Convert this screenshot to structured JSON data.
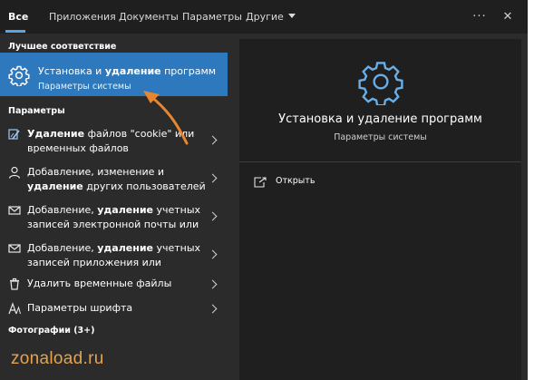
{
  "tabs": [
    {
      "label": "Все",
      "active": true
    },
    {
      "label": "Приложения"
    },
    {
      "label": "Документы"
    },
    {
      "label": "Параметры"
    },
    {
      "label": "Другие"
    }
  ],
  "top_icons": {
    "more": "···",
    "close": "✕"
  },
  "best_match": {
    "header": "Лучшее соответствие",
    "title_plain": "Установка и ",
    "title_bold": "удаление",
    "title_rest": " программ",
    "subtitle": "Параметры системы",
    "icon": "gear-icon"
  },
  "settings": {
    "header": "Параметры",
    "items": [
      {
        "icon": "cleanup-icon",
        "line1_bold": "Удаление",
        "line1_rest": " файлов \"cookie\" или",
        "line2": "временных файлов"
      },
      {
        "icon": "person-icon",
        "line1_plain": "Добавление, изменение и",
        "line2_bold": "удаление",
        "line2_rest": " других пользователей"
      },
      {
        "icon": "mail-icon",
        "line1_plain": "Добавление, ",
        "line1_bold": "удаление",
        "line1_rest": " учетных",
        "line2": "записей электронной почты или"
      },
      {
        "icon": "mail-icon",
        "line1_plain": "Добавление, ",
        "line1_bold": "удаление",
        "line1_rest": " учетных",
        "line2": "записей приложения или"
      },
      {
        "icon": "trash-icon",
        "line1_plain": "Удалить временные файлы"
      },
      {
        "icon": "font-icon",
        "line1_plain": "Параметры шрифта"
      }
    ]
  },
  "photos_header": "Фотографии (3+)",
  "preview": {
    "title": "Установка и удаление программ",
    "subtitle": "Параметры системы",
    "open_label": "Открыть"
  },
  "watermark": "zonaload.ru",
  "colors": {
    "accent": "#2e78bd",
    "arrow": "#e8862f",
    "panel": "#2b2b2b",
    "preview": "#1f1f1f"
  }
}
